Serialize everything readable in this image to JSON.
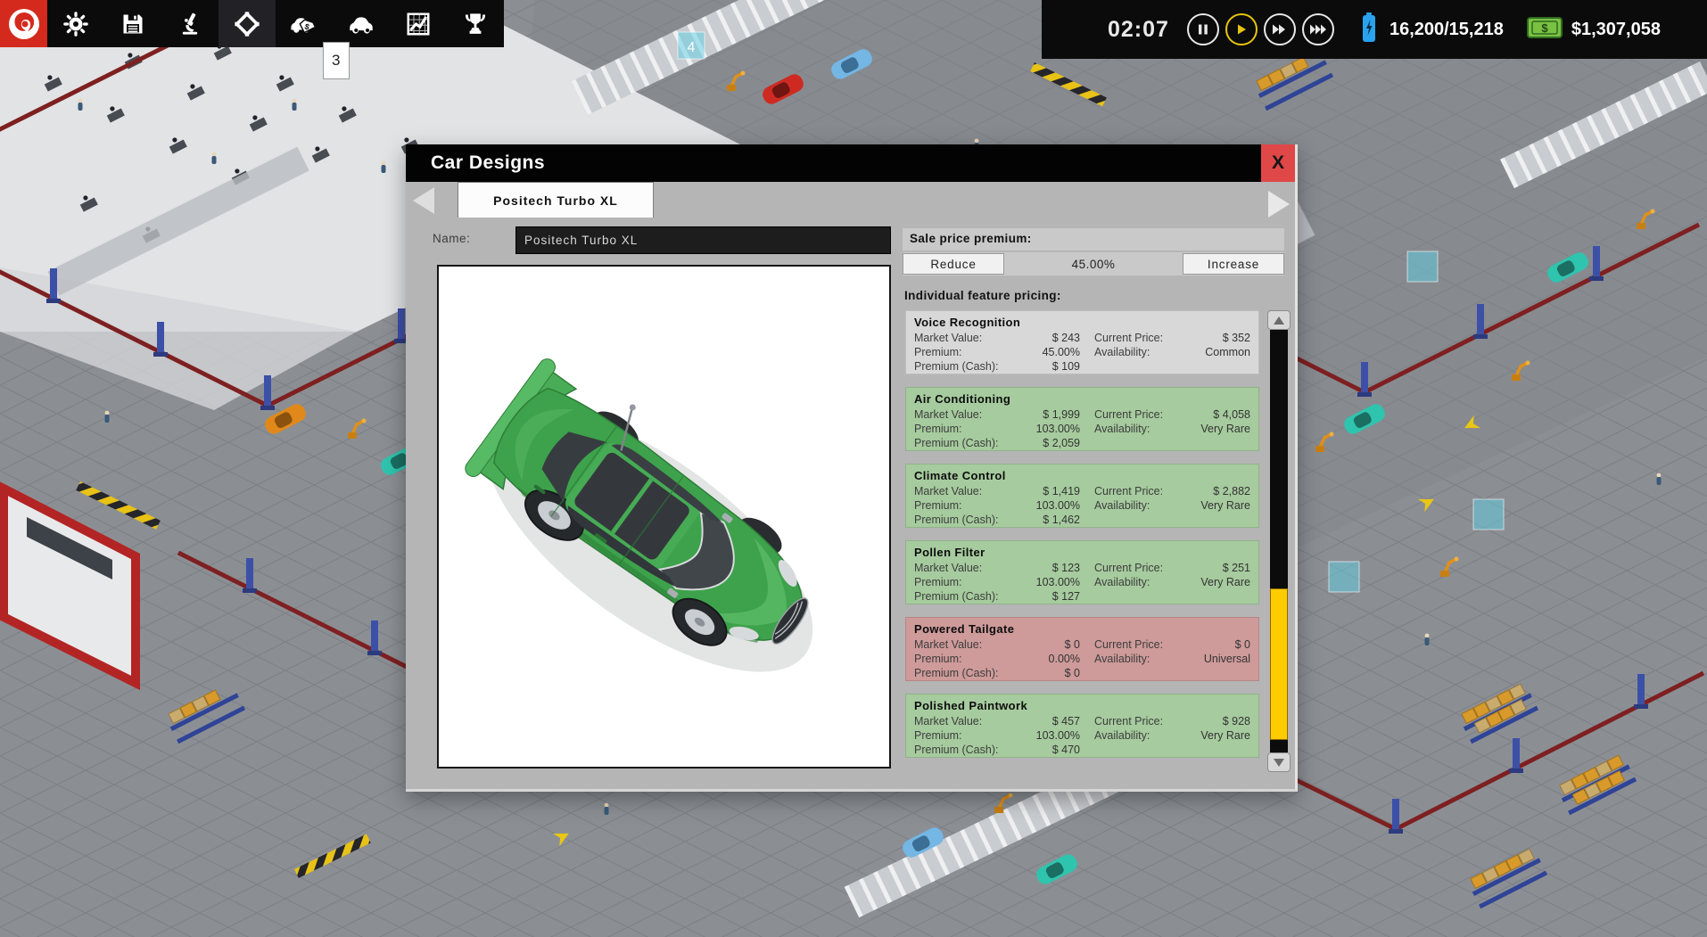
{
  "toolbar": {
    "badge": "3",
    "icons": [
      "positech-logo",
      "settings-icon",
      "save-icon",
      "research-icon",
      "zone-icon",
      "car-sales-icon",
      "car-designs-icon",
      "stats-icon",
      "achievements-icon"
    ],
    "clock": "02:07",
    "playback": [
      "pause-icon",
      "play-icon",
      "fast-forward-icon",
      "fastest-forward-icon"
    ],
    "resources": "16,200/15,218",
    "money": "$1,307,058"
  },
  "factory": {
    "badge_4": "4"
  },
  "dialog": {
    "title": "Car Designs",
    "close_label": "X",
    "tab": "Positech Turbo XL",
    "name_label": "Name:",
    "name_value": "Positech Turbo XL",
    "sale_price": {
      "header": "Sale price premium:",
      "reduce": "Reduce",
      "value": "45.00%",
      "increase": "Increase"
    },
    "feature_header": "Individual feature pricing:",
    "row_labels": {
      "market_value": "Market Value:",
      "current_price": "Current Price:",
      "premium": "Premium:",
      "availability": "Availability:",
      "premium_cash": "Premium (Cash):"
    },
    "features": [
      {
        "name": "Voice Recognition",
        "market_value": "$ 243",
        "current_price": "$ 352",
        "premium": "45.00%",
        "availability": "Common",
        "premium_cash": "$ 109",
        "status": "neutral"
      },
      {
        "name": "Air Conditioning",
        "market_value": "$ 1,999",
        "current_price": "$ 4,058",
        "premium": "103.00%",
        "availability": "Very Rare",
        "premium_cash": "$ 2,059",
        "status": "good"
      },
      {
        "name": "Climate Control",
        "market_value": "$ 1,419",
        "current_price": "$ 2,882",
        "premium": "103.00%",
        "availability": "Very Rare",
        "premium_cash": "$ 1,462",
        "status": "good"
      },
      {
        "name": "Pollen Filter",
        "market_value": "$ 123",
        "current_price": "$ 251",
        "premium": "103.00%",
        "availability": "Very Rare",
        "premium_cash": "$ 127",
        "status": "good"
      },
      {
        "name": "Powered Tailgate",
        "market_value": "$ 0",
        "current_price": "$ 0",
        "premium": "0.00%",
        "availability": "Universal",
        "premium_cash": "$ 0",
        "status": "bad"
      },
      {
        "name": "Polished Paintwork",
        "market_value": "$ 457",
        "current_price": "$ 928",
        "premium": "103.00%",
        "availability": "Very Rare",
        "premium_cash": "$ 470",
        "status": "good"
      }
    ]
  },
  "colors": {
    "status": {
      "neutral": "#d8d8d8",
      "good": "#a6cb9e",
      "bad": "#ce9a9a"
    },
    "scrollbar_thumb": "#ffcc00",
    "close_button": "#e04747",
    "money_green": "#7ac143",
    "battery_blue": "#29a3f0",
    "car_green": "#3da24b"
  }
}
